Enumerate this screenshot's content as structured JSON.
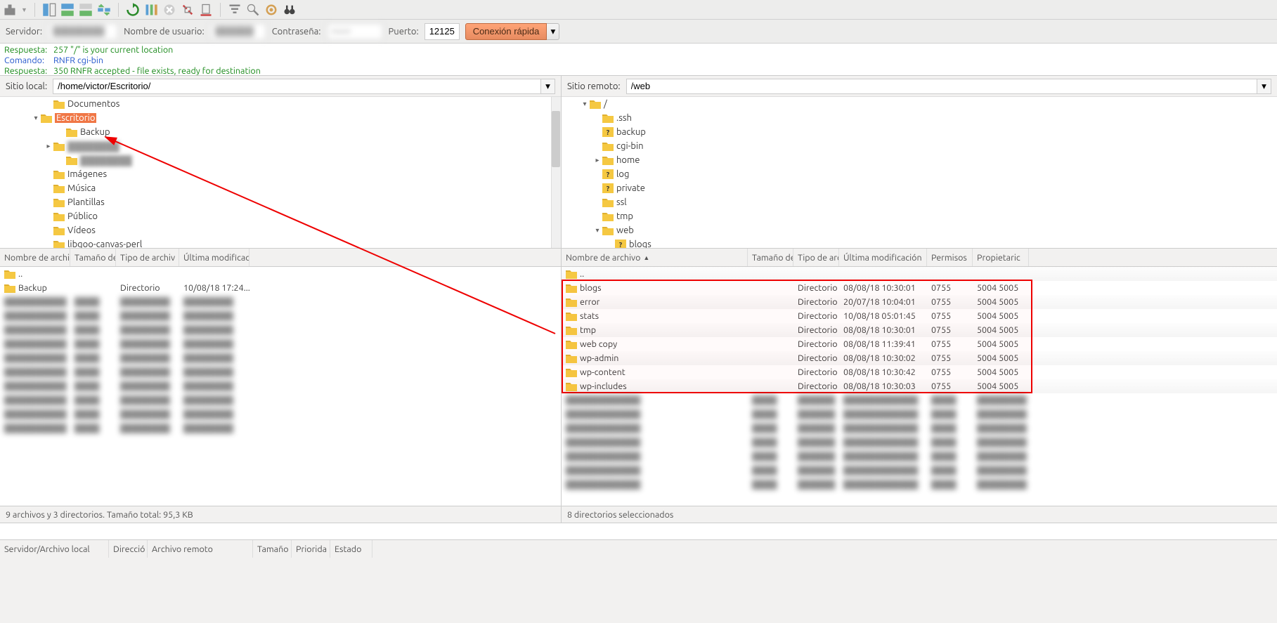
{
  "toolbar_icons": [
    "site-manager",
    "toggle-local",
    "toggle-remote",
    "toggle-transfer",
    "sync-browse",
    "refresh",
    "process-queue",
    "cancel",
    "disconnect",
    "reconnect",
    "filter",
    "toggle-dir-compare",
    "search",
    "bookmark",
    "binoculars"
  ],
  "conn": {
    "host_label": "Servidor:",
    "user_label": "Nombre de usuario:",
    "pass_label": "Contraseña:",
    "port_label": "Puerto:",
    "port_value": "12125",
    "quick_label": "Conexión rápida"
  },
  "log": [
    {
      "type": "Respuesta:",
      "msg": "257 \"/\" is your current location",
      "cls": "green"
    },
    {
      "type": "Comando:",
      "msg": "RNFR cgi-bin",
      "cls": "blue"
    },
    {
      "type": "Respuesta:",
      "msg": "350 RNFR accepted - file exists, ready for destination",
      "cls": "green"
    }
  ],
  "local": {
    "path_label": "Sitio local:",
    "path": "/home/victor/Escritorio/",
    "tree": [
      {
        "indent": 3,
        "exp": "",
        "label": "Documentos"
      },
      {
        "indent": 2,
        "exp": "▾",
        "label": "Escritorio",
        "sel": true
      },
      {
        "indent": 4,
        "exp": "",
        "label": "Backup"
      },
      {
        "indent": 3,
        "exp": "▸",
        "label": "████████",
        "blur": true
      },
      {
        "indent": 4,
        "exp": "",
        "label": "████████",
        "blur": true
      },
      {
        "indent": 3,
        "exp": "",
        "label": "Imágenes"
      },
      {
        "indent": 3,
        "exp": "",
        "label": "Música"
      },
      {
        "indent": 3,
        "exp": "",
        "label": "Plantillas"
      },
      {
        "indent": 3,
        "exp": "",
        "label": "Público"
      },
      {
        "indent": 3,
        "exp": "",
        "label": "Vídeos"
      },
      {
        "indent": 3,
        "exp": "",
        "label": "libgoo-canvas-perl"
      }
    ],
    "headers": [
      "Nombre de archiv",
      "Tamaño de",
      "Tipo de archiv",
      "Última modificac"
    ],
    "rows": [
      {
        "name": "..",
        "size": "",
        "type": "",
        "date": ""
      },
      {
        "name": "Backup",
        "size": "",
        "type": "Directorio",
        "date": "10/08/18 17:24..."
      }
    ],
    "blur_count": 10,
    "status": "9 archivos y 3 directorios. Tamaño total: 95,3 KB"
  },
  "remote": {
    "path_label": "Sitio remoto:",
    "path": "/web",
    "tree": [
      {
        "indent": 1,
        "exp": "▾",
        "label": "/",
        "icon": "f"
      },
      {
        "indent": 2,
        "exp": "",
        "label": ".ssh",
        "icon": "f"
      },
      {
        "indent": 2,
        "exp": "",
        "label": "backup",
        "icon": "q"
      },
      {
        "indent": 2,
        "exp": "",
        "label": "cgi-bin",
        "icon": "f"
      },
      {
        "indent": 2,
        "exp": "▸",
        "label": "home",
        "icon": "f"
      },
      {
        "indent": 2,
        "exp": "",
        "label": "log",
        "icon": "q"
      },
      {
        "indent": 2,
        "exp": "",
        "label": "private",
        "icon": "q"
      },
      {
        "indent": 2,
        "exp": "",
        "label": "ssl",
        "icon": "f"
      },
      {
        "indent": 2,
        "exp": "",
        "label": "tmp",
        "icon": "f"
      },
      {
        "indent": 2,
        "exp": "▾",
        "label": "web",
        "icon": "f"
      },
      {
        "indent": 3,
        "exp": "",
        "label": "blogs",
        "icon": "q"
      }
    ],
    "headers": [
      "Nombre de archivo",
      "Tamaño de",
      "Tipo de arc",
      "Última modificación",
      "Permisos",
      "Propietaric"
    ],
    "rows": [
      {
        "name": "..",
        "size": "",
        "type": "",
        "date": "",
        "perm": "",
        "own": ""
      },
      {
        "name": "blogs",
        "size": "",
        "type": "Directorio",
        "date": "08/08/18 10:30:01",
        "perm": "0755",
        "own": "5004 5005"
      },
      {
        "name": "error",
        "size": "",
        "type": "Directorio",
        "date": "20/07/18 10:04:01",
        "perm": "0755",
        "own": "5004 5005"
      },
      {
        "name": "stats",
        "size": "",
        "type": "Directorio",
        "date": "10/08/18 05:01:45",
        "perm": "0755",
        "own": "5004 5005"
      },
      {
        "name": "tmp",
        "size": "",
        "type": "Directorio",
        "date": "08/08/18 10:30:01",
        "perm": "0755",
        "own": "5004 5005"
      },
      {
        "name": "web copy",
        "size": "",
        "type": "Directorio",
        "date": "08/08/18 11:39:41",
        "perm": "0755",
        "own": "5004 5005"
      },
      {
        "name": "wp-admin",
        "size": "",
        "type": "Directorio",
        "date": "08/08/18 10:30:02",
        "perm": "0755",
        "own": "5004 5005"
      },
      {
        "name": "wp-content",
        "size": "",
        "type": "Directorio",
        "date": "08/08/18 10:30:42",
        "perm": "0755",
        "own": "5004 5005"
      },
      {
        "name": "wp-includes",
        "size": "",
        "type": "Directorio",
        "date": "08/08/18 10:30:03",
        "perm": "0755",
        "own": "5004 5005"
      }
    ],
    "blur_count": 7,
    "status": "8 directorios seleccionados"
  },
  "queue_headers": [
    "Servidor/Archivo local",
    "Direcció",
    "Archivo remoto",
    "Tamaño",
    "Priorida",
    "Estado"
  ],
  "colors": {
    "accent": "#f07746"
  }
}
